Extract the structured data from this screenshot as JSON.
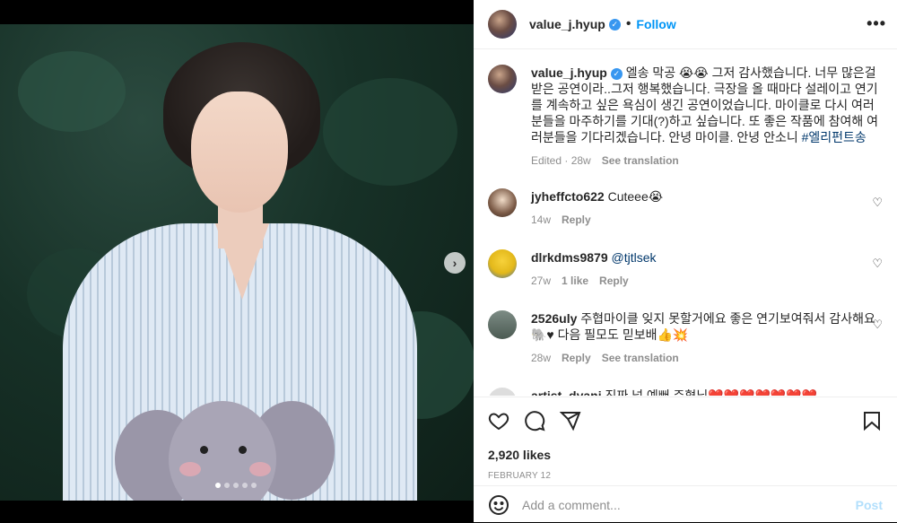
{
  "post": {
    "username": "value_j.hyup",
    "follow_label": "Follow",
    "separator": "•",
    "more_label": "•••"
  },
  "caption": {
    "username": "value_j.hyup",
    "text": " 엘송 막공 😭😭 그저 감사했습니다. 너무 많은걸 받은 공연이라..그저 행복했습니다. 극장을 올 때마다 설레이고 연기를 계속하고 싶은 욕심이 생긴 공연이었습니다. 마이클로 다시 여러분들을 마주하기를 기대(?)하고 싶습니다. 또 좋은 작품에 참여해 여러분들을 기다리겠습니다. 안녕 마이클. 안녕 안소니 ",
    "hashtag": "#엘리펀트송",
    "edited": "Edited · 28w",
    "see_translation": "See translation"
  },
  "comments": [
    {
      "username": "jyheffcto622",
      "text": "Cuteee😭",
      "mention": "",
      "time": "14w",
      "likes": "",
      "reply": "Reply",
      "translate": ""
    },
    {
      "username": "dlrkdms9879",
      "text": "",
      "mention": "@tjtlsek",
      "time": "27w",
      "likes": "1 like",
      "reply": "Reply",
      "translate": ""
    },
    {
      "username": "2526uly",
      "text": "주협마이클 잊지 못할거에요 좋은 연기보여줘서 감사해요🐘♥ 다음 필모도 믿보배👍💥",
      "mention": "",
      "time": "28w",
      "likes": "",
      "reply": "Reply",
      "translate": "See translation"
    },
    {
      "username": "artist_dyani",
      "text": "진짜 넘 예뻐 주협님❤️❤️❤️❤️❤️❤️❤️",
      "mention": "",
      "time": "",
      "likes": "",
      "reply": "",
      "translate": ""
    }
  ],
  "footer": {
    "likes": "2,920 likes",
    "date": "FEBRUARY 12",
    "comment_placeholder": "Add a comment...",
    "post_label": "Post"
  },
  "media": {
    "next_label": "›",
    "slides_total": 5,
    "slide_active": 1
  },
  "colors": {
    "link": "#0095f6",
    "hashtag": "#00376b",
    "muted": "#8e8e8e",
    "verified": "#3897f0"
  }
}
